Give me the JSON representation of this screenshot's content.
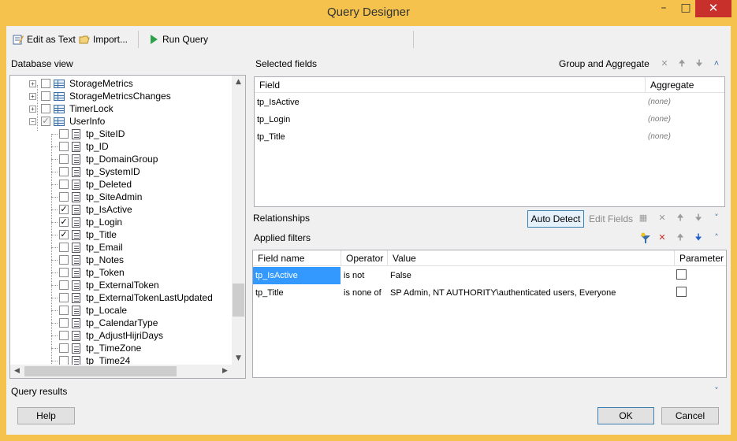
{
  "window": {
    "title": "Query Designer"
  },
  "toolbar": {
    "edit_as_text": "Edit as Text",
    "import": "Import...",
    "run_query": "Run Query"
  },
  "database_view": {
    "title": "Database view",
    "tables": [
      {
        "name": "StorageMetrics",
        "expanded": false,
        "checked": false
      },
      {
        "name": "StorageMetricsChanges",
        "expanded": false,
        "checked": false
      },
      {
        "name": "TimerLock",
        "expanded": false,
        "checked": false
      },
      {
        "name": "UserInfo",
        "expanded": true,
        "checked": "partial"
      }
    ],
    "columns": [
      {
        "name": "tp_SiteID",
        "checked": false
      },
      {
        "name": "tp_ID",
        "checked": false
      },
      {
        "name": "tp_DomainGroup",
        "checked": false
      },
      {
        "name": "tp_SystemID",
        "checked": false
      },
      {
        "name": "tp_Deleted",
        "checked": false
      },
      {
        "name": "tp_SiteAdmin",
        "checked": false
      },
      {
        "name": "tp_IsActive",
        "checked": true
      },
      {
        "name": "tp_Login",
        "checked": true
      },
      {
        "name": "tp_Title",
        "checked": true
      },
      {
        "name": "tp_Email",
        "checked": false
      },
      {
        "name": "tp_Notes",
        "checked": false
      },
      {
        "name": "tp_Token",
        "checked": false
      },
      {
        "name": "tp_ExternalToken",
        "checked": false
      },
      {
        "name": "tp_ExternalTokenLastUpdated",
        "checked": false
      },
      {
        "name": "tp_Locale",
        "checked": false
      },
      {
        "name": "tp_CalendarType",
        "checked": false
      },
      {
        "name": "tp_AdjustHijriDays",
        "checked": false
      },
      {
        "name": "tp_TimeZone",
        "checked": false
      },
      {
        "name": "tp_Time24",
        "checked": false
      }
    ]
  },
  "selected_fields": {
    "title": "Selected fields",
    "group_and_aggregate": "Group and Aggregate",
    "headers": {
      "field": "Field",
      "aggregate": "Aggregate"
    },
    "rows": [
      {
        "field": "tp_IsActive",
        "aggregate": "(none)"
      },
      {
        "field": "tp_Login",
        "aggregate": "(none)"
      },
      {
        "field": "tp_Title",
        "aggregate": "(none)"
      }
    ]
  },
  "relationships": {
    "title": "Relationships",
    "auto_detect": "Auto Detect",
    "edit_fields": "Edit Fields"
  },
  "applied_filters": {
    "title": "Applied filters",
    "headers": {
      "field_name": "Field name",
      "operator": "Operator",
      "value": "Value",
      "parameter": "Parameter"
    },
    "rows": [
      {
        "field": "tp_IsActive",
        "operator": "is not",
        "value": "False",
        "parameter": false
      },
      {
        "field": "tp_Title",
        "operator": "is none of",
        "value": "SP Admin, NT AUTHORITY\\authenticated users, Everyone",
        "parameter": false
      }
    ]
  },
  "query_results": {
    "title": "Query results"
  },
  "footer": {
    "help": "Help",
    "ok": "OK",
    "cancel": "Cancel"
  },
  "colors": {
    "title_bar": "#f5c34d",
    "close_button": "#c7302b",
    "selection": "#3399ff"
  }
}
